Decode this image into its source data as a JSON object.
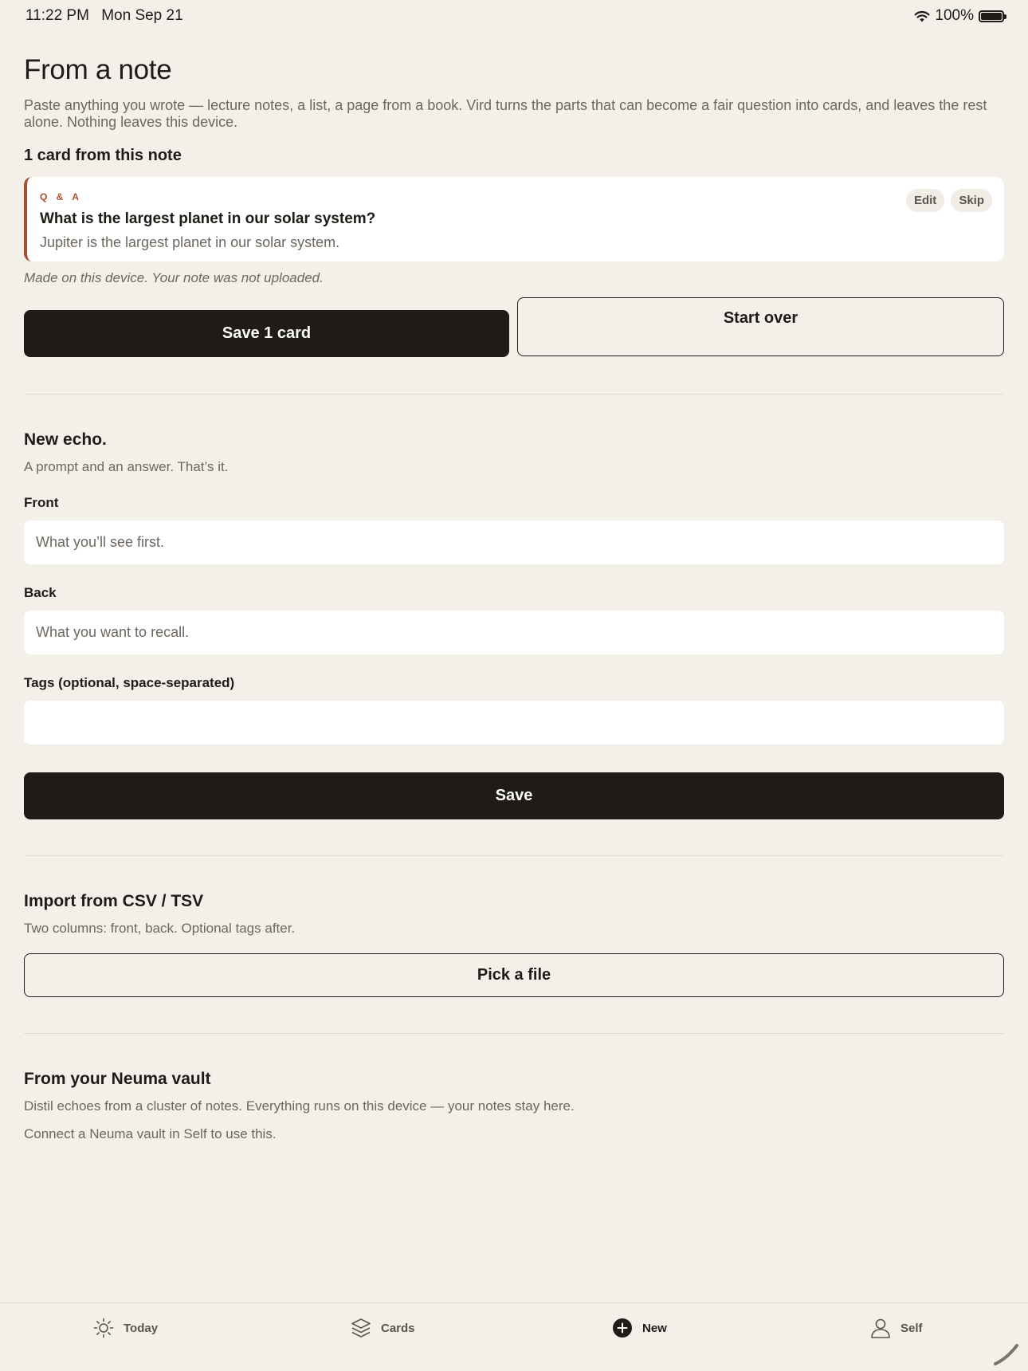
{
  "status_bar": {
    "time": "11:22 PM",
    "date": "Mon Sep 21",
    "battery": "100%",
    "battery_level": 1.0
  },
  "note_section": {
    "title": "From a note",
    "intro": "Paste anything you wrote — lecture notes, a list, a page from a book. Vird turns the parts that can become a fair question into cards, and leaves the rest alone. Nothing leaves this device.",
    "count_label": "1 card from this note",
    "card": {
      "tag": "Q & A",
      "question": "What is the largest planet in our solar system?",
      "answer": "Jupiter is the largest planet in our solar system.",
      "edit_label": "Edit",
      "skip_label": "Skip",
      "accent_color": "#a6502f"
    },
    "privacy_note": "Made on this device. Your note was not uploaded.",
    "save_label": "Save 1 card",
    "start_over_label": "Start over"
  },
  "new_echo": {
    "title": "New echo.",
    "description": "A prompt and an answer. That’s it.",
    "front_label": "Front",
    "front_placeholder": "What you’ll see first.",
    "back_label": "Back",
    "back_placeholder": "What you want to recall.",
    "tags_label": "Tags (optional, space-separated)",
    "tags_value": "",
    "save_label": "Save"
  },
  "import": {
    "title": "Import from CSV / TSV",
    "description": "Two columns: front, back. Optional tags after.",
    "pick_label": "Pick a file"
  },
  "vault": {
    "title": "From your Neuma vault",
    "description": "Distil echoes from a cluster of notes. Everything runs on this device — your notes stay here.",
    "connect_hint": "Connect a Neuma vault in Self to use this."
  },
  "tab_bar": {
    "today": "Today",
    "cards": "Cards",
    "new": "New",
    "self": "Self",
    "active": "new",
    "icons": [
      "sun-icon",
      "stack-icon",
      "plus-circle-icon",
      "person-icon"
    ]
  }
}
